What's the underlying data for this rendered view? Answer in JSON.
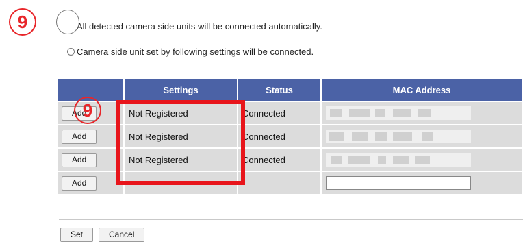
{
  "callouts": {
    "top": "9",
    "table": "9"
  },
  "options": {
    "auto_label": "All detected camera side units will be connected automatically.",
    "manual_label": "Camera side unit set by following settings will be connected.",
    "selected": "auto"
  },
  "table": {
    "headers": [
      "",
      "Settings",
      "Status",
      "MAC Address"
    ],
    "rows": [
      {
        "action": "Add",
        "settings": "Not Registered",
        "status": "Connected",
        "mac": ""
      },
      {
        "action": "Add",
        "settings": "Not Registered",
        "status": "Connected",
        "mac": ""
      },
      {
        "action": "Add",
        "settings": "Not Registered",
        "status": "Connected",
        "mac": ""
      },
      {
        "action": "Add",
        "settings": "–",
        "status": "–",
        "mac": ""
      }
    ]
  },
  "buttons": {
    "set": "Set",
    "cancel": "Cancel"
  },
  "colors": {
    "header_bg": "#4b62a6",
    "cell_bg": "#dcdcdc",
    "highlight": "#e8151b"
  }
}
